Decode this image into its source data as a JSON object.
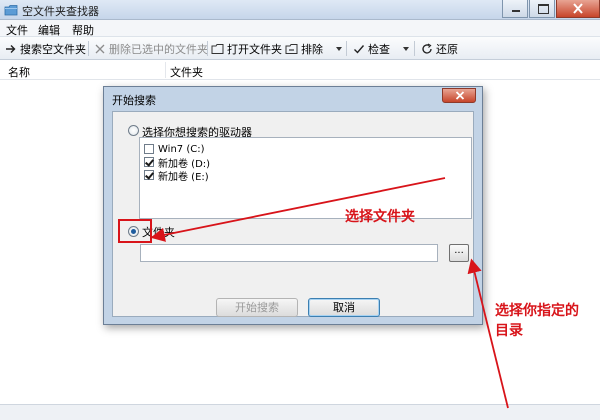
{
  "window": {
    "title": "空文件夹查找器"
  },
  "menu": [
    "文件",
    "编辑",
    "帮助"
  ],
  "toolbar": {
    "search_empty": "搜索空文件夹",
    "delete_selected": "删除已选中的文件夹",
    "open_folder": "打开文件夹",
    "exclude": "排除",
    "check": "检查",
    "restore": "还原"
  },
  "list": {
    "columns": [
      "名称",
      "文件夹"
    ]
  },
  "dialog": {
    "title": "开始搜索",
    "radio_drives": "选择你想搜索的驱动器",
    "drives": [
      {
        "label": "Win7 (C:)",
        "checked": false
      },
      {
        "label": "新加卷 (D:)",
        "checked": true
      },
      {
        "label": "新加卷 (E:)",
        "checked": true
      }
    ],
    "radio_folder": "文件夹",
    "folder_path": "",
    "browse_label": "...",
    "start_button": "开始搜索",
    "cancel_button": "取消"
  },
  "annotations": {
    "select_folder": "选择文件夹",
    "select_dir_line1": "选择你指定的",
    "select_dir_line2": "目录",
    "color": "#d8141a"
  },
  "colors": {
    "title_bar": "#c6d6ea",
    "dialog_frame": "#c2d3e6",
    "close_red": "#c7452b"
  }
}
